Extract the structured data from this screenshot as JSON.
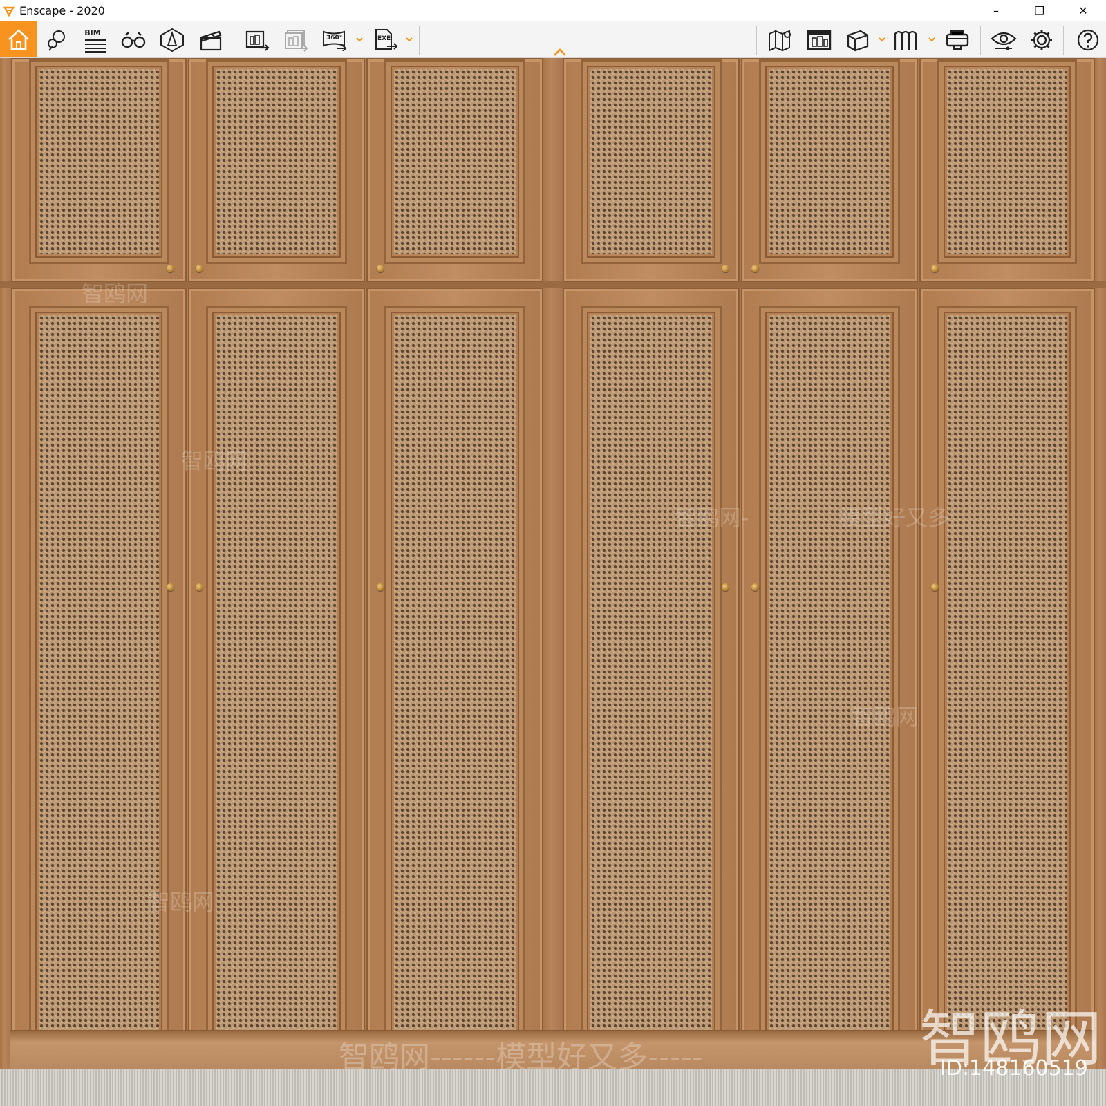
{
  "window": {
    "title": "Enscape - 2020",
    "minimize_label": "–",
    "restore_label": "❐",
    "close_label": "✕"
  },
  "toolbar": {
    "bim_label": "BIM",
    "pano_label": "360°",
    "exe_label": "EXE",
    "accent_color": "#f7931e",
    "icons": [
      "home-icon",
      "view-management-icon",
      "bim-icon",
      "walk-fly-mode-icon",
      "asset-library-icon",
      "video-editor-icon",
      "screenshot-icon",
      "batch-render-icon",
      "panorama-icon",
      "exe-export-icon",
      "map-icon",
      "render-settings-icon",
      "material-editor-icon",
      "atlas-icon",
      "vr-headset-icon",
      "visual-settings-icon",
      "settings-icon",
      "help-icon"
    ]
  },
  "viewport": {
    "watermark_bottom": "智鸥网------模型好又多-----",
    "watermark_logo": "智鸥网",
    "watermark_id": "ID:148160519",
    "watermark_faint": [
      "智鸥网",
      "智鸥网",
      "智鸥网",
      "智鸥网",
      "智鸥网-",
      "模型好又多"
    ]
  }
}
